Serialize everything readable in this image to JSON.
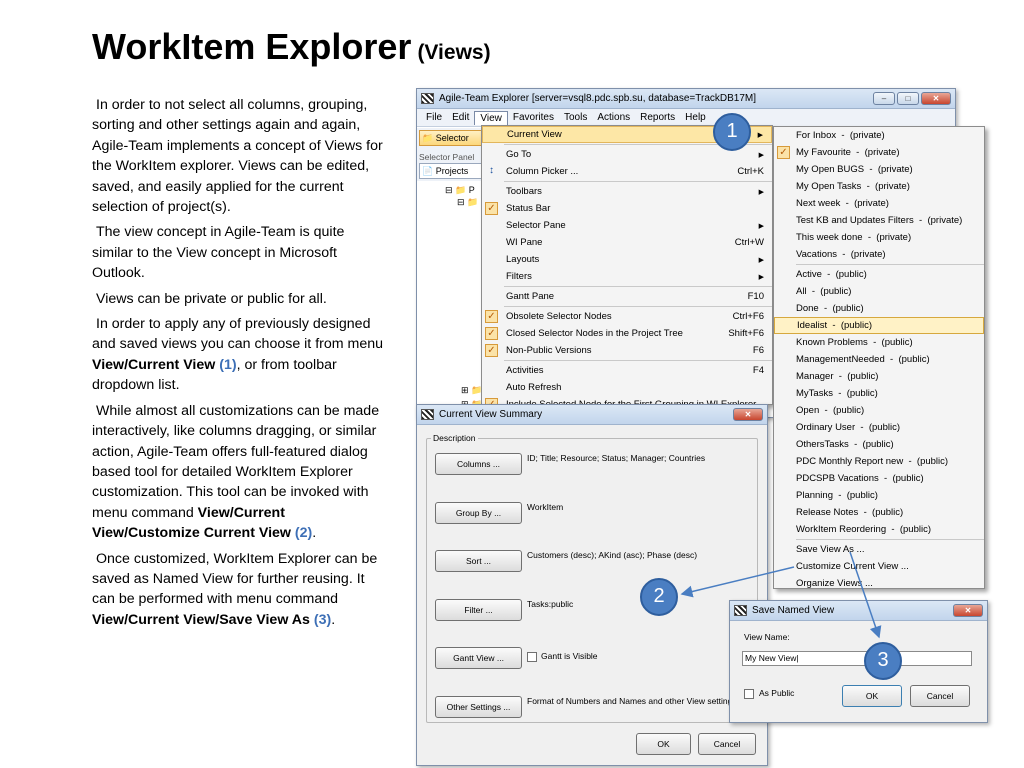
{
  "slide": {
    "title": "WorkItem Explorer",
    "subtitle": "(Views)",
    "paragraphs": [
      {
        "pre": "In order to not select all columns, grouping, sorting and other settings again and again, Agile-Team implements a concept of Views for the WorkItem explorer. Views can be edited, saved, and easily applied for the current selection of project(s).",
        "b1": "",
        "r1": "",
        "mid": "",
        "b2": "",
        "r2": "",
        "post": ""
      },
      {
        "pre": "The view concept in Agile-Team is quite similar to the View concept in Microsoft Outlook.",
        "b1": "",
        "r1": "",
        "mid": "",
        "b2": "",
        "r2": "",
        "post": ""
      },
      {
        "pre": "Views can be private or public for all.",
        "b1": "",
        "r1": "",
        "mid": "",
        "b2": "",
        "r2": "",
        "post": ""
      },
      {
        "pre": "In order to apply any of previously designed and saved views you can choose it from menu ",
        "b1": "View/Current View",
        "r1": "(1)",
        "mid": ", or from toolbar dropdown list.",
        "b2": "",
        "r2": "",
        "post": ""
      },
      {
        "pre": "While almost all customizations can be made interactively, like columns dragging, or similar action, Agile-Team offers full-featured dialog based tool for detailed WorkItem Explorer customization. This tool can be invoked with menu command ",
        "b1": "View/Current View/Customize Current View",
        "r1": "(2)",
        "mid": ".",
        "b2": "",
        "r2": "",
        "post": ""
      },
      {
        "pre": "Once customized, WorkItem Explorer can be saved as Named View for further reusing. It can be performed with menu command ",
        "b1": "View/Current View/Save View As",
        "r1": "(3)",
        "mid": ".",
        "b2": "",
        "r2": "",
        "post": ""
      }
    ]
  },
  "app": {
    "title": "Agile-Team Explorer [server=vsql8.pdc.spb.su, database=TrackDB17M]",
    "menu": [
      "File",
      "Edit",
      "View",
      "Favorites",
      "Tools",
      "Actions",
      "Reports",
      "Help"
    ],
    "selector_btn": "Selector",
    "selector_panel": "Selector Panel",
    "projects_tab": "Projects",
    "tree_root": "P"
  },
  "view_menu": [
    {
      "label": "Current View",
      "sc": "",
      "arrow": true,
      "check": false,
      "hl": true
    },
    {
      "label": "Go To",
      "sc": "",
      "arrow": true,
      "check": false,
      "sep_before": true
    },
    {
      "label": "Column Picker ...",
      "sc": "Ctrl+K",
      "arrow": false,
      "check": false,
      "icon": "column-picker-icon"
    },
    {
      "label": "Toolbars",
      "sc": "",
      "arrow": true,
      "check": false,
      "sep_before": true
    },
    {
      "label": "Status Bar",
      "sc": "",
      "arrow": false,
      "check": true
    },
    {
      "label": "Selector Pane",
      "sc": "",
      "arrow": true,
      "check": false
    },
    {
      "label": "WI Pane",
      "sc": "Ctrl+W",
      "arrow": false,
      "check": false
    },
    {
      "label": "Layouts",
      "sc": "",
      "arrow": true,
      "check": false
    },
    {
      "label": "Filters",
      "sc": "",
      "arrow": true,
      "check": false
    },
    {
      "label": "Gantt Pane",
      "sc": "F10",
      "arrow": false,
      "check": false,
      "sep_before": true
    },
    {
      "label": "Obsolete Selector Nodes",
      "sc": "Ctrl+F6",
      "arrow": false,
      "check": true,
      "sep_before": true
    },
    {
      "label": "Closed Selector Nodes in the Project Tree",
      "sc": "Shift+F6",
      "arrow": false,
      "check": true
    },
    {
      "label": "Non-Public Versions",
      "sc": "F6",
      "arrow": false,
      "check": true
    },
    {
      "label": "Activities",
      "sc": "F4",
      "arrow": false,
      "check": false,
      "sep_before": true
    },
    {
      "label": "Auto Refresh",
      "sc": "",
      "arrow": false,
      "check": false
    },
    {
      "label": "Include Selected Node for the First Grouping in WI Explorer",
      "sc": "",
      "arrow": false,
      "check": true
    }
  ],
  "views_submenu": [
    {
      "name": "For Inbox",
      "scope": "(private)"
    },
    {
      "name": "My Favourite",
      "scope": "(private)",
      "check": true
    },
    {
      "name": "My Open BUGS",
      "scope": "(private)"
    },
    {
      "name": "My Open Tasks",
      "scope": "(private)"
    },
    {
      "name": "Next week",
      "scope": "(private)"
    },
    {
      "name": "Test KB and Updates Filters",
      "scope": "(private)"
    },
    {
      "name": "This week done",
      "scope": "(private)"
    },
    {
      "name": "Vacations",
      "scope": "(private)"
    },
    {
      "name": "Active",
      "scope": "(public)",
      "sep_before": true
    },
    {
      "name": "All",
      "scope": "(public)"
    },
    {
      "name": "Done",
      "scope": "(public)"
    },
    {
      "name": "Idealist",
      "scope": "(public)",
      "selected": true
    },
    {
      "name": "Known Problems",
      "scope": "(public)"
    },
    {
      "name": "ManagementNeeded",
      "scope": "(public)"
    },
    {
      "name": "Manager",
      "scope": "(public)"
    },
    {
      "name": "MyTasks",
      "scope": "(public)"
    },
    {
      "name": "Open",
      "scope": "(public)"
    },
    {
      "name": "Ordinary User",
      "scope": "(public)"
    },
    {
      "name": "OthersTasks",
      "scope": "(public)"
    },
    {
      "name": "PDC Monthly Report new",
      "scope": "(public)"
    },
    {
      "name": "PDCSPB Vacations",
      "scope": "(public)"
    },
    {
      "name": "Planning",
      "scope": "(public)"
    },
    {
      "name": "Release Notes",
      "scope": "(public)"
    },
    {
      "name": "WorkItem Reordering",
      "scope": "(public)"
    }
  ],
  "views_actions": [
    "Save View As ...",
    "Customize Current View ...",
    "Organize Views ..."
  ],
  "summary_dialog": {
    "title": "Current View Summary",
    "group": "Description",
    "rows": [
      {
        "btn": "Columns ...",
        "value": "ID; Title; Resource; Status; Manager; Countries"
      },
      {
        "btn": "Group By ...",
        "value": "WorkItem"
      },
      {
        "btn": "Sort ...",
        "value": "Customers (desc); AKind (asc); Phase (desc)"
      },
      {
        "btn": "Filter ...",
        "value": "Tasks:public"
      },
      {
        "btn": "Gantt View ...",
        "value": "Gantt is Visible"
      },
      {
        "btn": "Other Settings ...",
        "value": "Format of Numbers and Names and other View settings"
      }
    ],
    "ok": "OK",
    "cancel": "Cancel"
  },
  "save_dialog": {
    "title": "Save Named View",
    "name_label": "View Name:",
    "name_value": "My New View",
    "public_label": "As Public",
    "ok": "OK",
    "cancel": "Cancel"
  },
  "badges": [
    "1",
    "2",
    "3"
  ],
  "colors": {
    "accent_blue": "#4a7ec2",
    "highlight": "#fde7a6",
    "title_bar": "#c2d5ec"
  }
}
